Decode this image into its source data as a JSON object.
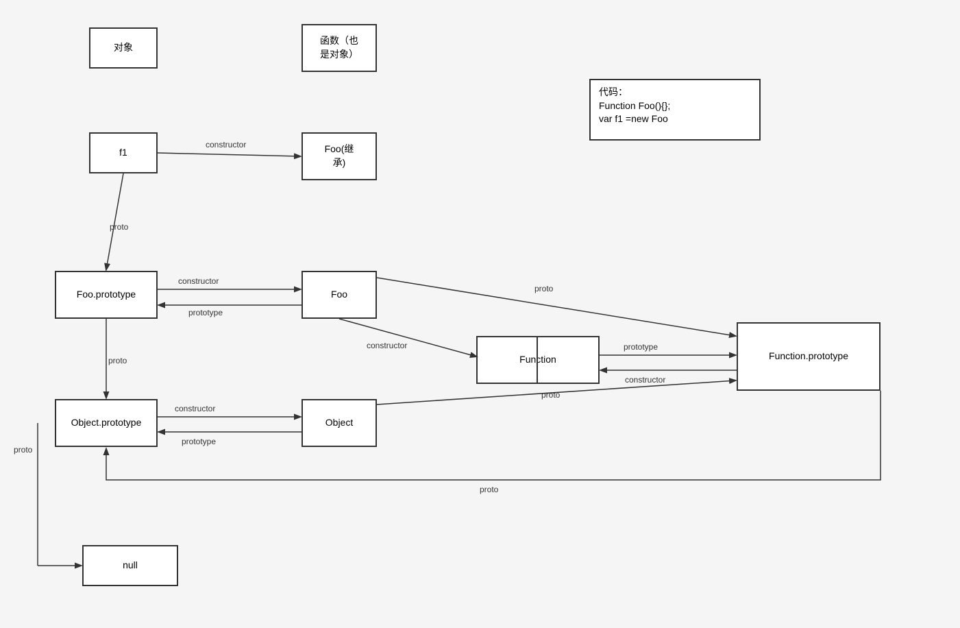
{
  "legend": {
    "object_label": "对象",
    "function_label": "函数（也\n是对象）"
  },
  "code_box": {
    "line1": "代码：",
    "line2": "Function Foo(){};",
    "line3": "var f1 =new Foo"
  },
  "boxes": {
    "f1": "f1",
    "foo_inherit": "Foo(继\n承)",
    "foo_prototype": "Foo.prototype",
    "foo": "Foo",
    "function": "Function",
    "function_prototype": "Function.prototype",
    "object_prototype": "Object.prototype",
    "object": "Object",
    "null": "null"
  },
  "arrows": {
    "f1_to_foo_inherit": "constructor",
    "f1_proto": "proto",
    "foo_prototype_to_foo": "constructor",
    "foo_to_foo_prototype": "prototype",
    "foo_to_function": "constructor",
    "foo_to_function_prototype": "proto",
    "function_to_function_prototype": "prototype",
    "function_prototype_to_function": "constructor",
    "function_prototype_to_object_prototype": "proto",
    "foo_prototype_to_object_prototype": "proto",
    "object_prototype_to_object": "constructor",
    "object_to_object_prototype": "prototype",
    "object_proto": "proto",
    "object_prototype_to_null": "proto",
    "null_proto": "proto"
  }
}
